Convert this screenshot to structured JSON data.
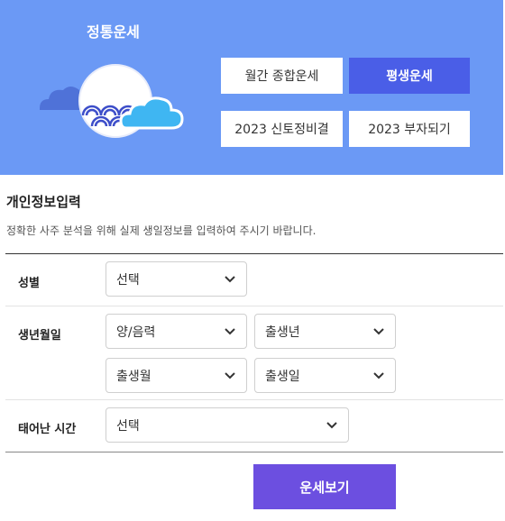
{
  "hero": {
    "title": "정통운세",
    "buttons": [
      {
        "label": "월간 종합운세",
        "active": false
      },
      {
        "label": "평생운세",
        "active": true
      },
      {
        "label": "2023 신토정비결",
        "active": false
      },
      {
        "label": "2023 부자되기",
        "active": false
      }
    ],
    "colors": {
      "background": "#6b99f5",
      "active_button": "#4a5ee7"
    }
  },
  "form": {
    "title": "개인정보입력",
    "description": "정확한 사주 분석을 위해 실제 생일정보를 입력하여 주시기 바랍니다.",
    "gender": {
      "label": "성별",
      "value": "선택"
    },
    "birth": {
      "label": "생년월일",
      "calendar": "양/음력",
      "year": "출생년",
      "month": "출생월",
      "day": "출생일"
    },
    "time": {
      "label": "태어난 시간",
      "value": "선택"
    },
    "submit_label": "운세보기",
    "colors": {
      "submit": "#6c4fe0"
    }
  }
}
